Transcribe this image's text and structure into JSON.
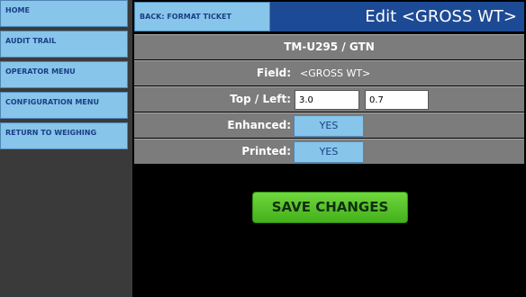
{
  "sidebar": {
    "items": [
      {
        "label": "HOME"
      },
      {
        "label": "AUDIT TRAIL"
      },
      {
        "label": "OPERATOR MENU"
      },
      {
        "label": "CONFIGURATION MENU"
      },
      {
        "label": "RETURN TO WEIGHING"
      }
    ]
  },
  "header": {
    "back_label": "BACK: FORMAT TICKET",
    "title": "Edit <GROSS WT>"
  },
  "printer_line": "TM-U295 / GTN",
  "form": {
    "field_label": "Field:",
    "field_value": "<GROSS WT>",
    "top_left_label": "Top / Left:",
    "top_value": "3.0",
    "left_value": "0.7",
    "enhanced_label": "Enhanced:",
    "enhanced_value": "YES",
    "printed_label": "Printed:",
    "printed_value": "YES"
  },
  "save_label": "SAVE CHANGES",
  "colors": {
    "nav_button": "#87c5ea",
    "title_bar": "#1d4a94",
    "row_bg": "#7c7c7c",
    "save_button": "#55c22a"
  }
}
